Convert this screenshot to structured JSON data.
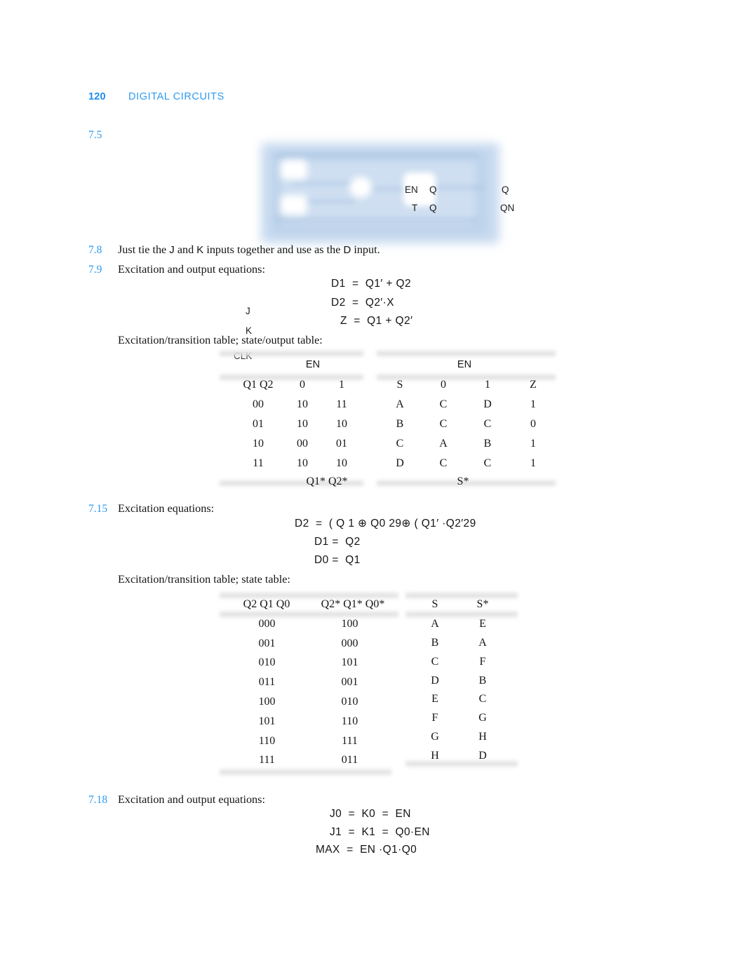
{
  "runhead": {
    "page_number": "120",
    "chapter_title": "DIGITAL CIRCUITS",
    "accent_color": "#2e9bf0"
  },
  "problems": [
    {
      "number": "7.5",
      "text": ""
    },
    {
      "number": "7.8",
      "text": "Just tie the J and K inputs together and use as the D input."
    },
    {
      "number": "7.9",
      "text": "Excitation and output equations:"
    },
    {
      "number": "7.15",
      "text": "Excitation equations:"
    },
    {
      "number": "7.18",
      "text": "Excitation and output equations:"
    }
  ],
  "figure_7_5": {
    "input_labels": [
      "J",
      "K",
      "CLK"
    ],
    "block_labels": [
      "EN",
      "Q",
      "T",
      "Q"
    ],
    "output_labels": [
      "Q",
      "QN"
    ],
    "fill_color": "#c3d7ee"
  },
  "problem_7_8": {
    "prefix": "Just tie the ",
    "j": "J",
    "mid1": " and ",
    "k": "K",
    "mid2": " inputs together and use as the ",
    "d": "D",
    "suffix": " input."
  },
  "problem_7_9": {
    "heading": "Excitation and output equations:",
    "equations": [
      "D1  =  Q1′ + Q2",
      "D2  =  Q2′·X",
      "Z  =  Q1 + Q2′"
    ],
    "tables_caption": "Excitation/transition table; state/output table:",
    "transition_table": {
      "spanner": "EN",
      "row_header": "Q1  Q2",
      "col_headers": [
        "0",
        "1"
      ],
      "rows": [
        {
          "state": "00",
          "en0": "10",
          "en1": "11"
        },
        {
          "state": "01",
          "en0": "10",
          "en1": "10"
        },
        {
          "state": "10",
          "en0": "00",
          "en1": "01"
        },
        {
          "state": "11",
          "en0": "10",
          "en1": "10"
        }
      ],
      "footer": "Q1*  Q2*"
    },
    "state_output_table": {
      "spanner": "EN",
      "row_header": "S",
      "col_headers": [
        "0",
        "1"
      ],
      "output_header": "Z",
      "rows": [
        {
          "state": "A",
          "en0": "C",
          "en1": "D",
          "z": "1"
        },
        {
          "state": "B",
          "en0": "C",
          "en1": "C",
          "z": "0"
        },
        {
          "state": "C",
          "en0": "A",
          "en1": "B",
          "z": "1"
        },
        {
          "state": "D",
          "en0": "C",
          "en1": "C",
          "z": "1"
        }
      ],
      "footer": "S*"
    }
  },
  "problem_7_15": {
    "heading": "Excitation equations:",
    "equations": [
      "D2  =  ( Q 1 ⊕ Q0 29⊕ ( Q1′ ·Q2′29",
      "D1 =  Q2",
      "D0 =  Q1"
    ],
    "tables_caption": "Excitation/transition table; state table:",
    "transition_table": {
      "col_headers_left": "Q2  Q1  Q0",
      "col_headers_right": "Q2*  Q1*  Q0*",
      "rows": [
        {
          "present": "000",
          "next": "100"
        },
        {
          "present": "001",
          "next": "000"
        },
        {
          "present": "010",
          "next": "101"
        },
        {
          "present": "011",
          "next": "001"
        },
        {
          "present": "100",
          "next": "010"
        },
        {
          "present": "101",
          "next": "110"
        },
        {
          "present": "110",
          "next": "111"
        },
        {
          "present": "111",
          "next": "011"
        }
      ]
    },
    "state_table": {
      "col_headers": [
        "S",
        "S*"
      ],
      "rows": [
        {
          "state": "A",
          "next": "E"
        },
        {
          "state": "B",
          "next": "A"
        },
        {
          "state": "C",
          "next": "F"
        },
        {
          "state": "D",
          "next": "B"
        },
        {
          "state": "E",
          "next": "C"
        },
        {
          "state": "F",
          "next": "G"
        },
        {
          "state": "G",
          "next": "H"
        },
        {
          "state": "H",
          "next": "D"
        }
      ]
    }
  },
  "problem_7_18": {
    "heading": "Excitation and output equations:",
    "equations": [
      "J0  =  K0  =  EN",
      "J1  =  K1  =  Q0·EN",
      "MAX  =  EN ·Q1·Q0"
    ]
  }
}
